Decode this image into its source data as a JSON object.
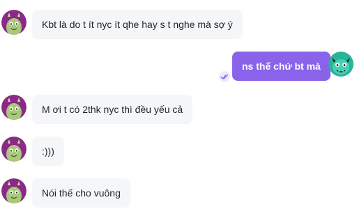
{
  "messages": [
    {
      "side": "in",
      "text": "Kbt là do t ít nyc ít qhe hay s t nghe mà sợ ý"
    },
    {
      "side": "out",
      "text": "ns thế chứ bt mà"
    },
    {
      "side": "in",
      "text": "M ơi t có 2thk nyc thì đều yếu cả"
    },
    {
      "side": "in",
      "text": ":)))"
    },
    {
      "side": "in",
      "text": "Nói thế cho vuông"
    }
  ],
  "icons": {
    "incoming_avatar": "green-monster-avatar",
    "outgoing_avatar": "teal-horned-monster-avatar",
    "seen": "double-check-icon"
  },
  "colors": {
    "outgoing_bubble": "#8a63ea",
    "incoming_bubble": "#f5f6f8",
    "incoming_avatar_bg": "#8a2a86",
    "outgoing_avatar_bg": "#2bb39a"
  }
}
